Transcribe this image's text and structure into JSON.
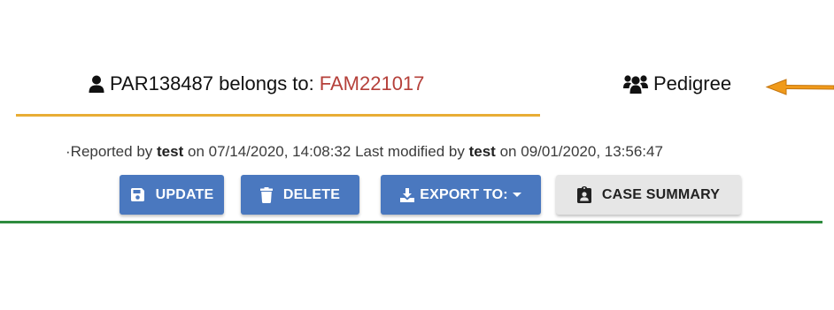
{
  "tabs": {
    "participant": {
      "icon": "user-icon",
      "prefix": "PAR138487 belongs to:",
      "family": "FAM221017"
    },
    "pedigree": {
      "icon": "users-icon",
      "label": "Pedigree"
    }
  },
  "colors": {
    "active_underline": "#e8ad35",
    "family_link": "#b5403a",
    "primary_button": "#4a78bf",
    "light_button": "#e6e6e6",
    "divider": "#2e8b3e",
    "arrow": "#f09a1a"
  },
  "meta": {
    "leading": "·Reported by",
    "reporter": "test",
    "reported_on_label": "on",
    "reported_on": "07/14/2020, 14:08:32",
    "modified_label": "Last modified by",
    "modifier": "test",
    "modified_on_label": "on",
    "modified_on": "09/01/2020, 13:56:47"
  },
  "actions": {
    "update": {
      "label": "UPDATE",
      "icon": "save-icon"
    },
    "delete": {
      "label": "DELETE",
      "icon": "trash-icon"
    },
    "export": {
      "label": "EXPORT TO:",
      "icon": "download-icon"
    },
    "case_summary": {
      "label": "CASE SUMMARY",
      "icon": "clipboard-user-icon"
    }
  }
}
